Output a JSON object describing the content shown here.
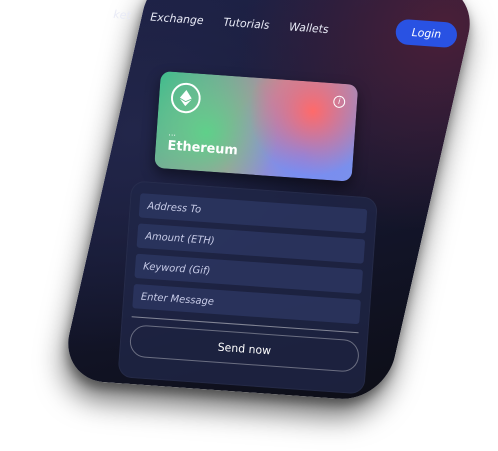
{
  "nav": {
    "items": [
      "ket",
      "Exchange",
      "Tutorials",
      "Wallets"
    ],
    "login_label": "Login"
  },
  "card": {
    "icon": "ethereum-icon",
    "address": "...",
    "title": "Ethereum"
  },
  "form": {
    "address_placeholder": "Address To",
    "amount_placeholder": "Amount (ETH)",
    "keyword_placeholder": "Keyword (Gif)",
    "message_placeholder": "Enter Message",
    "send_label": "Send now"
  },
  "colors": {
    "accent": "#2952e3",
    "background_dark": "#161934",
    "card_green": "#3fbe8c",
    "card_red": "#ff6a6a",
    "card_blue": "#6e8cff"
  }
}
